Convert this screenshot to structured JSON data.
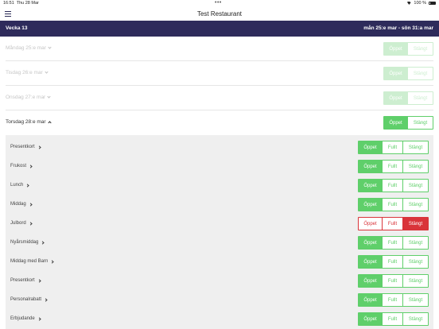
{
  "status": {
    "time": "16:51",
    "date": "Thu 28 Mar",
    "battery": "100 %"
  },
  "nav": {
    "title": "Test Restaurant"
  },
  "week": {
    "label": "Vecka 13",
    "range": "mån 25:e mar - sön 31:a mar"
  },
  "days": [
    {
      "label": "Måndag 25:e mar",
      "open": "Öppet",
      "closed": "Stängt"
    },
    {
      "label": "Tisdag 26:e mar",
      "open": "Öppet",
      "closed": "Stängt"
    },
    {
      "label": "Onsdag 27:e mar",
      "open": "Öppet",
      "closed": "Stängt"
    },
    {
      "label": "Torsdag 28:e mar",
      "open": "Öppet",
      "closed": "Stängt"
    }
  ],
  "services": [
    {
      "label": "Presentkort",
      "open": "Öppet",
      "full": "Fullt",
      "closed": "Stängt"
    },
    {
      "label": "Frukost",
      "open": "Öppet",
      "full": "Fullt",
      "closed": "Stängt"
    },
    {
      "label": "Lunch",
      "open": "Öppet",
      "full": "Fullt",
      "closed": "Stängt"
    },
    {
      "label": "Middag",
      "open": "Öppet",
      "full": "Fullt",
      "closed": "Stängt"
    },
    {
      "label": "Julbord",
      "open": "Öppet",
      "full": "Fullt",
      "closed": "Stängt"
    },
    {
      "label": "Nyårsmiddag",
      "open": "Öppet",
      "full": "Fullt",
      "closed": "Stängt"
    },
    {
      "label": "Middag med Barn",
      "open": "Öppet",
      "full": "Fullt",
      "closed": "Stängt"
    },
    {
      "label": "Presentkort",
      "open": "Öppet",
      "full": "Fullt",
      "closed": "Stängt"
    },
    {
      "label": "Personalrabatt",
      "open": "Öppet",
      "full": "Fullt",
      "closed": "Stängt"
    },
    {
      "label": "Erbjudande",
      "open": "Öppet",
      "full": "Fullt",
      "closed": "Stängt"
    }
  ],
  "colors": {
    "green": "#5fcf6a",
    "red": "#d9343a",
    "header": "#2e2b5b"
  }
}
